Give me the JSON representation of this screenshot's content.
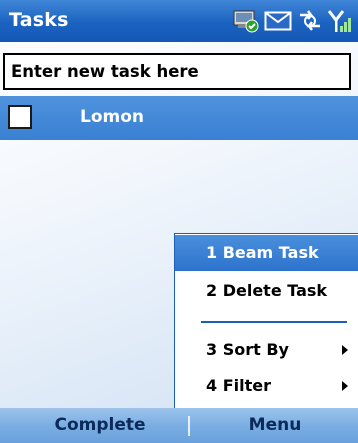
{
  "title_bar": {
    "title": "Tasks",
    "icons": [
      "sync-icon",
      "message-envelope-icon",
      "data-connection-icon",
      "signal-strength-icon"
    ]
  },
  "new_task": {
    "placeholder": "Enter new task here"
  },
  "tasks": [
    {
      "label": "Lomon",
      "completed": false
    }
  ],
  "context_menu": {
    "items": [
      {
        "label": "1 Beam Task",
        "selected": true,
        "submenu": false
      },
      {
        "label": "2 Delete Task",
        "selected": false,
        "submenu": false
      },
      {
        "label": "3 Sort By",
        "selected": false,
        "submenu": true
      },
      {
        "label": "4 Filter",
        "selected": false,
        "submenu": true
      }
    ]
  },
  "softkeys": {
    "left": "Complete",
    "right": "Menu"
  },
  "colors": {
    "title_bar": "#1c63c1",
    "selection": "#3a80d3",
    "softkey_bar": "#7aaee3",
    "menu_border": "#1d5fb8"
  }
}
